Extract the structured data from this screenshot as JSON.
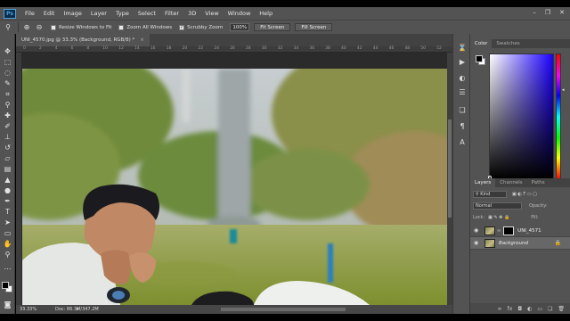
{
  "menubar": {
    "logo": "Ps",
    "items": [
      "File",
      "Edit",
      "Image",
      "Layer",
      "Type",
      "Select",
      "Filter",
      "3D",
      "View",
      "Window",
      "Help"
    ]
  },
  "options": {
    "resize_windows": "Resize Windows to Fit",
    "zoom_all": "Zoom All Windows",
    "scrubby_zoom": "Scrubby Zoom",
    "zoom_value": "100%",
    "fit_screen": "Fit Screen",
    "fill_screen": "Fill Screen"
  },
  "document": {
    "tab_title": "UNI_4570.jpg @ 33.3% (Background, RGB/8) *",
    "ruler_ticks": [
      "0",
      "2",
      "4",
      "6",
      "8",
      "10",
      "12",
      "14",
      "16",
      "18",
      "20",
      "22",
      "24",
      "26",
      "28",
      "30",
      "32",
      "34",
      "36",
      "38",
      "40",
      "42",
      "44",
      "46",
      "48",
      "50",
      "52"
    ]
  },
  "status": {
    "zoom": "33.33%",
    "doc": "Doc: 86.3M/347.2M"
  },
  "color_panel": {
    "tabs": [
      "Color",
      "Swatches"
    ],
    "fg": "#000000",
    "bg": "#ffffff"
  },
  "layers_panel": {
    "tabs": [
      "Layers",
      "Channels",
      "Paths"
    ],
    "kind": "Kind",
    "blend": "Normal",
    "opacity_label": "Opacity:",
    "lock_label": "Lock:",
    "fill_label": "Fill:",
    "layers": [
      {
        "name": "UNI_4571",
        "italic": false
      },
      {
        "name": "Background",
        "italic": true
      }
    ]
  }
}
